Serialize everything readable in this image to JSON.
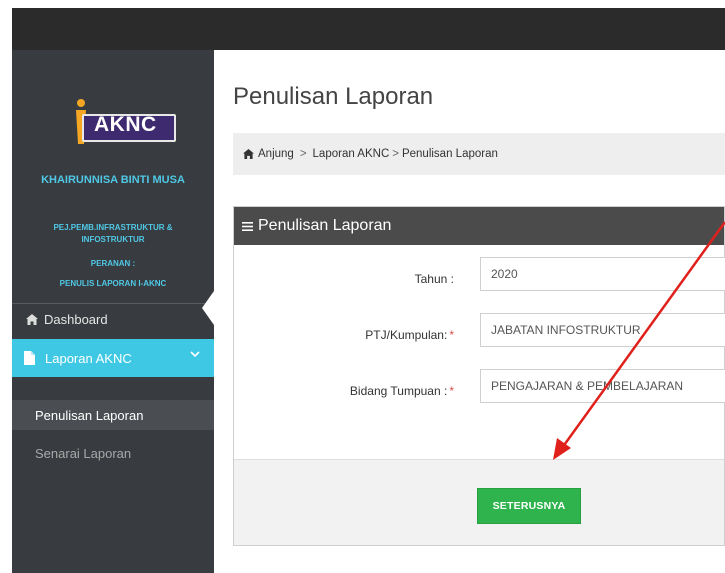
{
  "sidebar": {
    "logo_text": "AKNC",
    "user_name": "KHAIRUNNISA BINTI MUSA",
    "user_position": "PEJ.PEMB.INFRASTRUKTUR & INFOSTRUKTUR",
    "role_label": "PERANAN :",
    "role_value": "PENULIS LAPORAN I-AKNC",
    "nav": {
      "dashboard": "Dashboard",
      "laporan": "Laporan AKNC",
      "sub_items": [
        "Penulisan Laporan",
        "Senarai Laporan"
      ]
    }
  },
  "page": {
    "title": "Penulisan Laporan",
    "breadcrumb": [
      "Anjung",
      "Laporan AKNC",
      "Penulisan Laporan"
    ]
  },
  "panel": {
    "header": "Penulisan Laporan",
    "fields": {
      "tahun_label": "Tahun :",
      "tahun_value": "2020",
      "ptj_label": "PTJ/Kumpulan:",
      "ptj_value": "JABATAN INFOSTRUKTUR",
      "bidang_label": "Bidang Tumpuan :",
      "bidang_value": "PENGAJARAN & PEMBELAJARAN"
    },
    "button": "SETERUSNYA"
  },
  "colors": {
    "accent": "#3fc8e4",
    "button": "#2fb34c",
    "annotation": "#e0201b",
    "required": "#d9534f"
  }
}
